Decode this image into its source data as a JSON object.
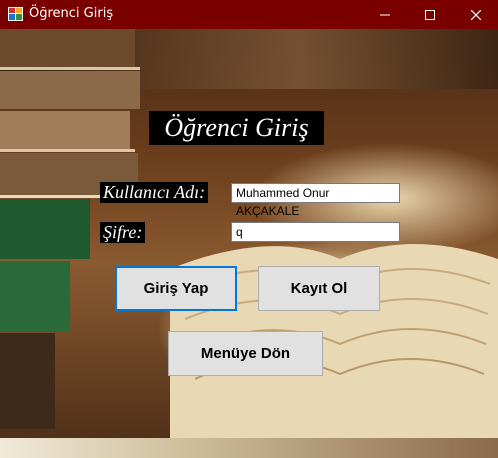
{
  "window": {
    "title": "Öğrenci Giriş",
    "controls": {
      "minimize": "minimize-icon",
      "maximize": "maximize-icon",
      "close": "close-icon"
    }
  },
  "form": {
    "heading": "Öğrenci Giriş",
    "username_label": "Kullanıcı Adı:",
    "username_value": "Muhammed Onur AKÇAKALE",
    "password_label": "Şifre:",
    "password_value": "q",
    "login_button": "Giriş Yap",
    "register_button": "Kayıt Ol",
    "menu_button": "Menüye Dön"
  },
  "colors": {
    "titlebar": "#7a0000",
    "focus_border": "#0078d7",
    "button_face": "#e1e1e1",
    "label_background": "#000000"
  }
}
